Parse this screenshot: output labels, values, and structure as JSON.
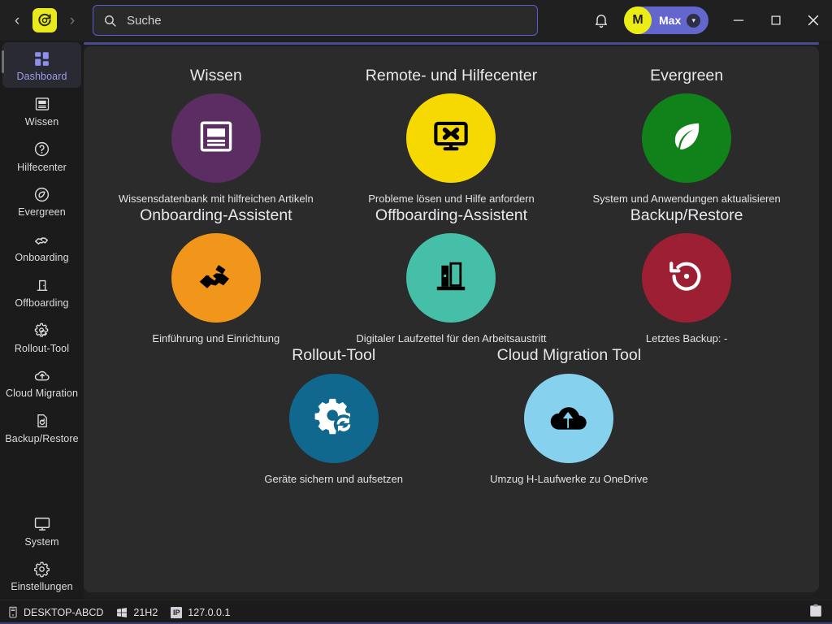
{
  "titlebar": {
    "back_label": "‹",
    "forward_label": "›",
    "logo_name": "app-logo",
    "search": {
      "value": "",
      "placeholder": "Suche"
    },
    "user": {
      "initial": "M",
      "name": "Max",
      "caret": "▾"
    },
    "window": {
      "minimize": "—",
      "maximize": "▫",
      "close": "✕"
    }
  },
  "sidebar": {
    "items": [
      {
        "label": "Dashboard",
        "icon": "dashboard-icon",
        "active": true
      },
      {
        "label": "Wissen",
        "icon": "article-icon",
        "active": false
      },
      {
        "label": "Hilfecenter",
        "icon": "help-circle-icon",
        "active": false
      },
      {
        "label": "Evergreen",
        "icon": "leaf-compass-icon",
        "active": false
      },
      {
        "label": "Onboarding",
        "icon": "handshake-icon",
        "active": false
      },
      {
        "label": "Offboarding",
        "icon": "door-exit-icon",
        "active": false
      },
      {
        "label": "Rollout-Tool",
        "icon": "gear-sync-icon",
        "active": false
      },
      {
        "label": "Cloud Migration",
        "icon": "cloud-upload-icon",
        "active": false
      },
      {
        "label": "Backup/Restore",
        "icon": "restore-page-icon",
        "active": false
      }
    ],
    "bottom_items": [
      {
        "label": "System",
        "icon": "monitor-icon"
      },
      {
        "label": "Einstellungen",
        "icon": "gear-icon"
      }
    ]
  },
  "main": {
    "tiles": [
      {
        "title": "Wissen",
        "subtitle": "Wissensdatenbank mit hilfreichen Artikeln",
        "color": "#5b2d63",
        "icon": "article-icon",
        "icon_color": "#ffffff"
      },
      {
        "title": "Remote- und Hilfecenter",
        "subtitle": "Probleme lösen und Hilfe anfordern",
        "color": "#f5d900",
        "icon": "remote-desktop-icon",
        "icon_color": "#000000"
      },
      {
        "title": "Evergreen",
        "subtitle": "System und Anwendungen aktualisieren",
        "color": "#11821a",
        "icon": "leaf-icon",
        "icon_color": "#ffffff"
      },
      {
        "title": "Onboarding-Assistent",
        "subtitle": "Einführung und Einrichtung",
        "color": "#f2961b",
        "icon": "handshake-icon",
        "icon_color": "#000000"
      },
      {
        "title": "Offboarding-Assistent",
        "subtitle": "Digitaler Laufzettel für den Arbeitsaustritt",
        "color": "#45bfa8",
        "icon": "door-exit-icon",
        "icon_color": "#000000"
      },
      {
        "title": "Backup/Restore",
        "subtitle": "Letztes Backup: -",
        "color": "#9c1f33",
        "icon": "restore-icon",
        "icon_color": "#ffffff"
      },
      {
        "title": "Rollout-Tool",
        "subtitle": "Geräte sichern und aufsetzen",
        "color": "#10688f",
        "icon": "gear-sync-icon",
        "icon_color": "#ffffff"
      },
      {
        "title": "Cloud Migration Tool",
        "subtitle": "Umzug H-Laufwerke zu OneDrive",
        "color": "#86d2ee",
        "icon": "cloud-upload-icon",
        "icon_color": "#000000"
      }
    ]
  },
  "statusbar": {
    "hostname": "DESKTOP-ABCD",
    "os_version": "21H2",
    "ip_address": "127.0.0.1",
    "windows_badge": "IP",
    "clipboard_icon": "clipboard-icon"
  },
  "colors": {
    "accent": "#5b5bd6",
    "accent_line": "#4b4b8f",
    "sidebar_bg": "#1b1b1b",
    "content_bg": "#2b2b2b",
    "titlebar_bg": "#202020"
  }
}
